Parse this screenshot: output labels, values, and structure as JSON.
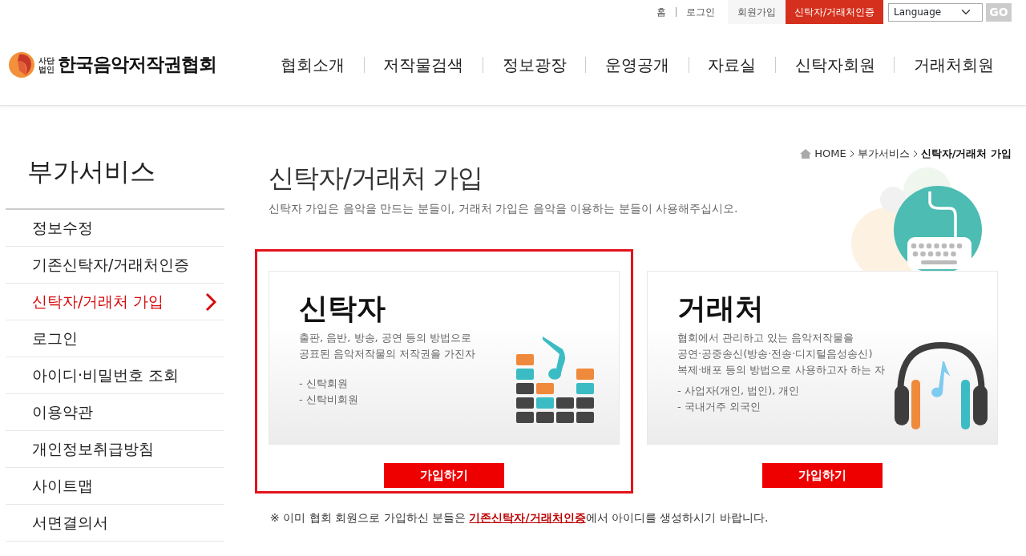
{
  "top_links": [
    {
      "label": "홈",
      "kind": "link"
    },
    {
      "label": "로그인",
      "kind": "link"
    },
    {
      "label": "회원가입",
      "kind": "tab"
    },
    {
      "label": "신탁자/거래처인증",
      "kind": "accent"
    }
  ],
  "language_select": {
    "value": "Language"
  },
  "go_button": "GO",
  "logo": {
    "prefix_top": "사단",
    "prefix_bottom": "법인",
    "name": "한국음악저작권협회"
  },
  "main_nav": [
    "협회소개",
    "저작물검색",
    "정보광장",
    "운영공개",
    "자료실",
    "신탁자회원",
    "거래처회원"
  ],
  "sidebar": {
    "title": "부가서비스",
    "items": [
      {
        "label": "정보수정",
        "selected": false
      },
      {
        "label": "기존신탁자/거래처인증",
        "selected": false
      },
      {
        "label": "신탁자/거래처 가입",
        "selected": true
      },
      {
        "label": "로그인",
        "selected": false
      },
      {
        "label": "아이디·비밀번호 조회",
        "selected": false
      },
      {
        "label": "이용약관",
        "selected": false
      },
      {
        "label": "개인정보취급방침",
        "selected": false
      },
      {
        "label": "사이트맵",
        "selected": false
      },
      {
        "label": "서면결의서",
        "selected": false
      }
    ]
  },
  "breadcrumb": [
    "HOME",
    "부가서비스",
    "신탁자/거래처 가입"
  ],
  "page": {
    "title": "신탁자/거래처 가입",
    "subtitle": "신탁자 가입은 음악을 만드는 분들이, 거래처 가입은 음악을 이용하는 분들이 사용해주십시오."
  },
  "cards": [
    {
      "kind": "trustee",
      "highlighted": true,
      "title": "신탁자",
      "description": [
        "출판, 음반, 방송, 공연 등의 방법으로",
        "공표된 음악저작물의 저작권을 가진자"
      ],
      "bullets": [
        "- 신탁회원",
        "- 신탁비회원"
      ],
      "button": "가입하기"
    },
    {
      "kind": "client",
      "highlighted": false,
      "title": "거래처",
      "description": [
        "협회에서 관리하고 있는 음악저작물을",
        "공연·공중송신(방송·전송·디지털음성송신)",
        "복제·배포 등의 방법으로 사용하고자 하는 자"
      ],
      "bullets": [
        "- 사업자(개인, 법인), 개인",
        "- 국내거주 외국인"
      ],
      "button": "가입하기"
    }
  ],
  "notice": {
    "text_before": "※ 이미 협회 회원으로 가입하신 분들은 ",
    "link": "기존신탁자/거래처인증",
    "text_after": "에서 아이디를 생성하시기 바랍니다."
  }
}
